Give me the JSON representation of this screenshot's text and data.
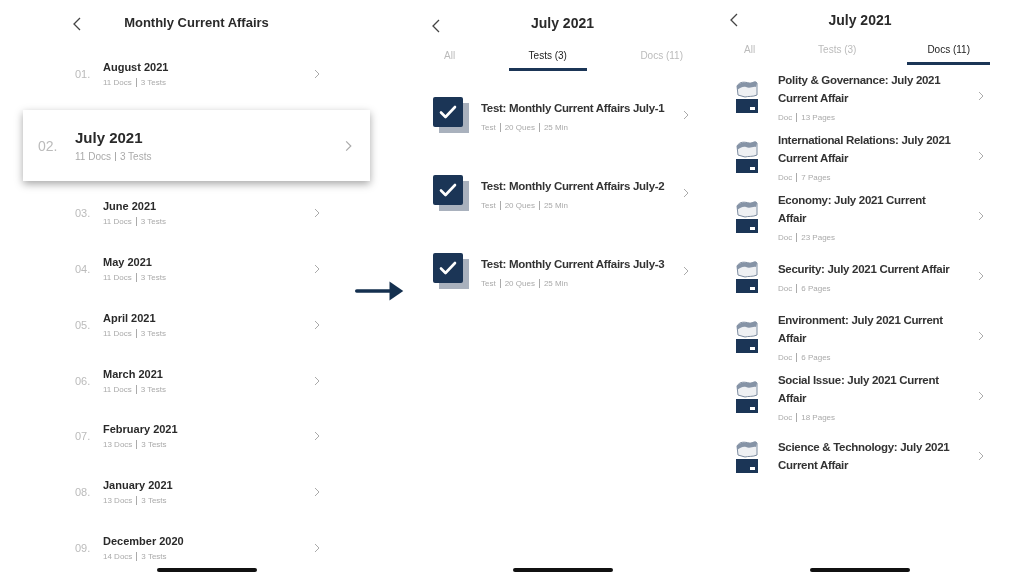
{
  "screens": [
    {
      "kind": "months",
      "title": "Monthly Current Affairs",
      "items": [
        {
          "number": "01.",
          "title": "August 2021",
          "docs": "11 Docs",
          "tests": "3 Tests",
          "selected": false
        },
        {
          "number": "02.",
          "title": "July 2021",
          "docs": "11 Docs",
          "tests": "3 Tests",
          "selected": true
        },
        {
          "number": "03.",
          "title": "June 2021",
          "docs": "11 Docs",
          "tests": "3 Tests",
          "selected": false
        },
        {
          "number": "04.",
          "title": "May 2021",
          "docs": "11 Docs",
          "tests": "3 Tests",
          "selected": false
        },
        {
          "number": "05.",
          "title": "April 2021",
          "docs": "11 Docs",
          "tests": "3 Tests",
          "selected": false
        },
        {
          "number": "06.",
          "title": "March 2021",
          "docs": "11 Docs",
          "tests": "3 Tests",
          "selected": false
        },
        {
          "number": "07.",
          "title": "February 2021",
          "docs": "13 Docs",
          "tests": "3 Tests",
          "selected": false
        },
        {
          "number": "08.",
          "title": "January 2021",
          "docs": "13 Docs",
          "tests": "3 Tests",
          "selected": false
        },
        {
          "number": "09.",
          "title": "December 2020",
          "docs": "14 Docs",
          "tests": "3 Tests",
          "selected": false
        }
      ]
    },
    {
      "kind": "tests",
      "title": "July 2021",
      "tabs": [
        {
          "label": "All",
          "selected": false
        },
        {
          "label": "Tests (3)",
          "selected": true
        },
        {
          "label": "Docs (11)",
          "selected": false
        }
      ],
      "items": [
        {
          "title": "Test: Monthly Current Affairs July-1",
          "type": "Test",
          "questions": "20 Ques",
          "duration": "25 Min",
          "checked": true
        },
        {
          "title": "Test: Monthly Current Affairs July-2",
          "type": "Test",
          "questions": "20 Ques",
          "duration": "25 Min",
          "checked": true
        },
        {
          "title": "Test: Monthly Current Affairs July-3",
          "type": "Test",
          "questions": "20 Ques",
          "duration": "25 Min",
          "checked": true
        }
      ]
    },
    {
      "kind": "docs",
      "title": "July 2021",
      "tabs": [
        {
          "label": "All",
          "selected": false
        },
        {
          "label": "Tests (3)",
          "selected": false
        },
        {
          "label": "Docs (11)",
          "selected": true
        }
      ],
      "items": [
        {
          "title": "Polity & Governance: July 2021 Current Affair",
          "type": "Doc",
          "pages": "13 Pages"
        },
        {
          "title": "International Relations: July 2021 Current Affair",
          "type": "Doc",
          "pages": "7 Pages"
        },
        {
          "title": "Economy: July 2021 Current Affair",
          "type": "Doc",
          "pages": "23 Pages"
        },
        {
          "title": "Security: July 2021 Current Affair",
          "type": "Doc",
          "pages": "6 Pages"
        },
        {
          "title": "Environment: July 2021 Current Affair",
          "type": "Doc",
          "pages": "6 Pages"
        },
        {
          "title": "Social Issue: July 2021 Current Affair",
          "type": "Doc",
          "pages": "18 Pages"
        },
        {
          "title": "Science & Technology: July 2021 Current Affair"
        }
      ]
    }
  ]
}
